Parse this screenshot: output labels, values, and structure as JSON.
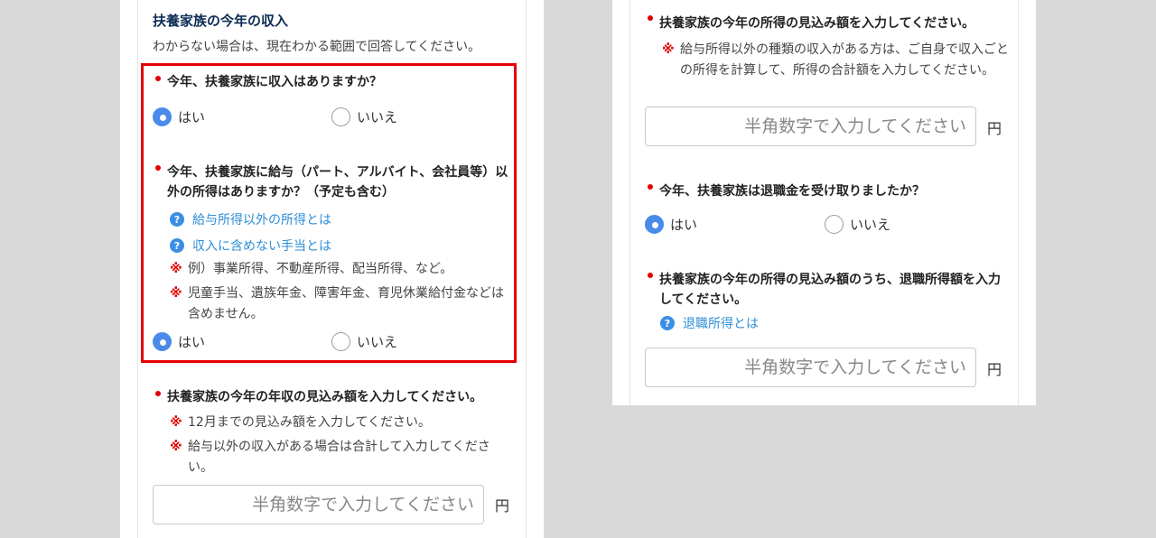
{
  "left": {
    "section_title": "扶養家族の今年の収入",
    "section_sub": "わからない場合は、現在わかる範囲で回答してください。",
    "q1": {
      "text": "今年、扶養家族に収入はありますか？",
      "yes": "はい",
      "no": "いいえ",
      "selected": "yes"
    },
    "q2": {
      "text": "今年、扶養家族に給与（パート、アルバイト、会社員等）以外の所得はありますか？（予定も含む）",
      "help1": "給与所得以外の所得とは",
      "help2": "収入に含めない手当とは",
      "note1": "例）事業所得、不動産所得、配当所得、など。",
      "note2": "児童手当、遺族年金、障害年金、育児休業給付金などは含めません。",
      "yes": "はい",
      "no": "いいえ",
      "selected": "yes"
    },
    "q3": {
      "text": "扶養家族の今年の年収の見込み額を入力してください。",
      "note1": "12月までの見込み額を入力してください。",
      "note2": "給与以外の収入がある場合は合計して入力してください。",
      "placeholder": "半角数字で入力してください",
      "value": "",
      "unit": "円"
    }
  },
  "right": {
    "q1": {
      "text": "扶養家族の今年の所得の見込み額を入力してください。",
      "note1": "給与所得以外の種類の収入がある方は、ご自身で収入ごとの所得を計算して、所得の合計額を入力してください。",
      "placeholder": "半角数字で入力してください",
      "value": "",
      "unit": "円"
    },
    "q2": {
      "text": "今年、扶養家族は退職金を受け取りましたか？",
      "yes": "はい",
      "no": "いいえ",
      "selected": "yes"
    },
    "q3": {
      "text": "扶養家族の今年の所得の見込み額のうち、退職所得額を入力してください。",
      "help1": "退職所得とは",
      "placeholder": "半角数字で入力してください",
      "value": "",
      "unit": "円"
    }
  },
  "colors": {
    "accent": "#4a8ae8",
    "required_dot": "#e00000",
    "note_mark": "#e00000",
    "link": "#2d8ed8",
    "highlight_border": "#e50000",
    "title": "#0c2c54"
  },
  "icons": {
    "help": "question-circle-icon",
    "note": "reference-mark-icon",
    "required": "required-dot-icon"
  }
}
